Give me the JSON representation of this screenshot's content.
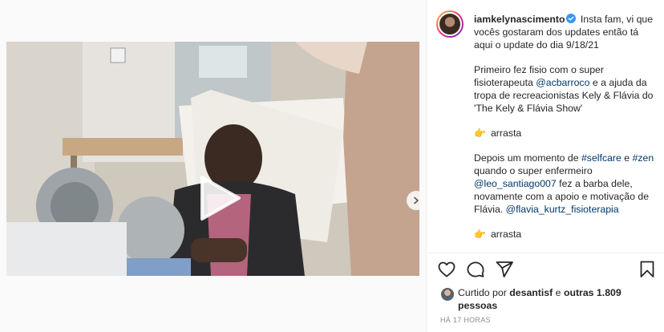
{
  "post": {
    "username": "iamkelynascimento",
    "caption_lines": {
      "p1": "Insta fam, vi que vocês gostaram dos updates então tá aqui o update do dia 9/18/21",
      "p2_a": "Primeiro fez fisio com o super fisioterapeuta ",
      "p2_mention": "@acbarroco",
      "p2_b": " e a ajuda da tropa de recreacionistas Kely & Flávia do 'The Kely & Flávia Show'",
      "p3": "arrasta",
      "p4_a": "Depois um momento de ",
      "p4_tag1": "#selfcare",
      "p4_b": " e ",
      "p4_tag2": "#zen",
      "p4_c": " quando o super enfermeiro ",
      "p4_mention1": "@leo_santiago007",
      "p4_d": " fez a barba dele, novamente com a apoio e motivação de Flávia. ",
      "p4_mention2": "@flavia_kurtz_fisioterapia",
      "p5": "arrasta"
    },
    "likes": {
      "prefix": "Curtido por ",
      "liker": "desantisf",
      "middle": " e ",
      "others": "outras 1.809 pessoas"
    },
    "timestamp": "HÁ 17 HORAS"
  },
  "icons": {
    "play": "play-icon",
    "next": "chevron-right-icon",
    "like": "heart-icon",
    "comment": "comment-icon",
    "share": "paper-plane-icon",
    "save": "bookmark-icon",
    "verified": "verified-badge-icon",
    "pointer": "pointing-hand-emoji"
  },
  "colors": {
    "link": "#00376b",
    "text": "#262626",
    "muted": "#8e8e8e",
    "verified": "#3897f0"
  }
}
